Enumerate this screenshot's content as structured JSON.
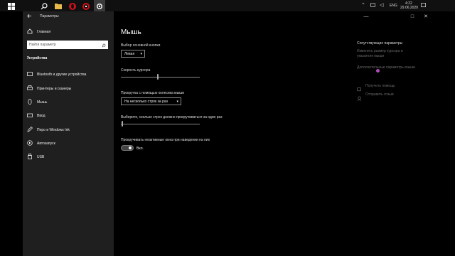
{
  "taskbar": {
    "tray": {
      "lang": "ENG",
      "time": "4:22",
      "date": "29.06.2020"
    }
  },
  "window": {
    "title": "Параметры",
    "minimize_label": "—",
    "maximize_label": "□",
    "close_label": "✕"
  },
  "sidebar": {
    "home_label": "Главная",
    "search_placeholder": "Найти параметр",
    "section_title": "Устройства",
    "items": [
      {
        "label": "Bluetooth и другие устройства",
        "icon": "bluetooth-icon"
      },
      {
        "label": "Принтеры и сканеры",
        "icon": "printer-icon"
      },
      {
        "label": "Мышь",
        "icon": "mouse-icon"
      },
      {
        "label": "Ввод",
        "icon": "keyboard-icon"
      },
      {
        "label": "Перо и Windows Ink",
        "icon": "pen-icon"
      },
      {
        "label": "Автозапуск",
        "icon": "autoplay-icon"
      },
      {
        "label": "USB",
        "icon": "usb-icon"
      }
    ]
  },
  "main": {
    "page_title": "Мышь",
    "primary_button": {
      "label": "Выбор основной кнопки",
      "value": "Левая"
    },
    "cursor_speed": {
      "label": "Скорость курсора",
      "level": 0.47
    },
    "wheel_scroll": {
      "label": "Прокрутка с помощью колесика мыши",
      "value": "На несколько строк за раз"
    },
    "lines_to_scroll": {
      "label": "Выберите, сколько строк должно прокручиваться за один раз",
      "level": 0.02
    },
    "inactive_scroll": {
      "label": "Прокручивать неактивные окна при наведении на них",
      "state": "Вкл."
    }
  },
  "related": {
    "title": "Сопутствующие параметры",
    "link1": "Изменить размер курсора и",
    "link1b": "указателя мыши",
    "link2": "Дополнительные параметры мыши",
    "help": "Получить помощь",
    "feedback": "Отправить отзыв"
  },
  "colors": {
    "sidebar": "#1f1f1f",
    "background": "#000000",
    "accent": "#0078d7"
  }
}
